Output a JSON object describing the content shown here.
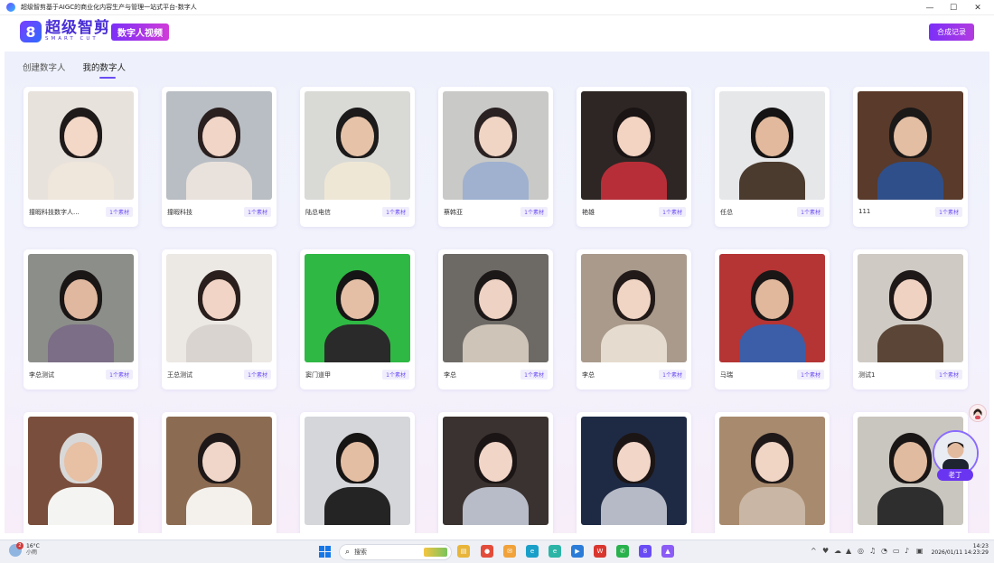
{
  "window": {
    "title": "超级智剪基于AIGC的商业化内容生产与管理一站式平台-数字人",
    "minimize_glyph": "—",
    "maximize_glyph": "☐",
    "close_glyph": "✕"
  },
  "header": {
    "logo_mark": "8",
    "logo_cn": "超级智剪",
    "logo_en": "SMART CUT",
    "product_badge": "数字人视频",
    "records_button": "合成记录"
  },
  "tabs": [
    {
      "label": "创建数字人",
      "active": false
    },
    {
      "label": "我的数字人",
      "active": true
    }
  ],
  "avatars": [
    {
      "name": "撞暇科技数字人...",
      "count": "1个素材",
      "bg": "#e8e2dc",
      "skin": "#f3d8c8",
      "hair": "#1f1a1a",
      "cloth": "#efe6dc"
    },
    {
      "name": "撞暇科技",
      "count": "1个素材",
      "bg": "#b9bec4",
      "skin": "#f1d6c8",
      "hair": "#2a2020",
      "cloth": "#e9e2dc"
    },
    {
      "name": "陆总电信",
      "count": "1个素材",
      "bg": "#d9dad6",
      "skin": "#e6c3a8",
      "hair": "#1c1a1a",
      "cloth": "#efe7d5"
    },
    {
      "name": "蔡韩亚",
      "count": "1个素材",
      "bg": "#c9c9c7",
      "skin": "#f0d5c5",
      "hair": "#2a2222",
      "cloth": "#9fb1cf"
    },
    {
      "name": "艳雄",
      "count": "1个素材",
      "bg": "#2d2624",
      "skin": "#f3d3c2",
      "hair": "#1a1414",
      "cloth": "#b82e38"
    },
    {
      "name": "任总",
      "count": "1个素材",
      "bg": "#e6e7e9",
      "skin": "#e2b99c",
      "hair": "#151313",
      "cloth": "#4b3a2e"
    },
    {
      "name": "111",
      "count": "1个素材",
      "bg": "#5a3a2a",
      "skin": "#e3bea3",
      "hair": "#1b1818",
      "cloth": "#2f4f8a"
    },
    {
      "name": "李总测试",
      "count": "1个素材",
      "bg": "#8c8e8a",
      "skin": "#e0b89f",
      "hair": "#1a1616",
      "cloth": "#7c6e86"
    },
    {
      "name": "王总测试",
      "count": "1个素材",
      "bg": "#ece8e3",
      "skin": "#f2d4c6",
      "hair": "#2a1f1c",
      "cloth": "#d9d4d0"
    },
    {
      "name": "窦门道甲",
      "count": "1个素材",
      "bg": "#2fb843",
      "skin": "#e4bfa6",
      "hair": "#151515",
      "cloth": "#2a2a2a"
    },
    {
      "name": "李总",
      "count": "1个素材",
      "bg": "#6d6a66",
      "skin": "#eed2c3",
      "hair": "#1d1818",
      "cloth": "#cfc4b8"
    },
    {
      "name": "李总",
      "count": "1个素材",
      "bg": "#a99a8c",
      "skin": "#f0d4c4",
      "hair": "#221a18",
      "cloth": "#e5dccf"
    },
    {
      "name": "马瑞",
      "count": "1个素材",
      "bg": "#b53434",
      "skin": "#e1b89c",
      "hair": "#1a1616",
      "cloth": "#3c5ea8"
    },
    {
      "name": "测试1",
      "count": "1个素材",
      "bg": "#cfcac4",
      "skin": "#f0d2c2",
      "hair": "#1f1818",
      "cloth": "#5a4536"
    },
    {
      "name": "",
      "count": "",
      "bg": "#7a4e3c",
      "skin": "#e8c0a4",
      "hair": "#d8d8d8",
      "cloth": "#f4f4f2"
    },
    {
      "name": "",
      "count": "",
      "bg": "#8b6b52",
      "skin": "#f0d6c8",
      "hair": "#1e1818",
      "cloth": "#f4f1ec"
    },
    {
      "name": "",
      "count": "",
      "bg": "#d4d6da",
      "skin": "#e4bea3",
      "hair": "#171414",
      "cloth": "#242424"
    },
    {
      "name": "",
      "count": "",
      "bg": "#3a3230",
      "skin": "#f1d5c7",
      "hair": "#1c1515",
      "cloth": "#b8bcc8"
    },
    {
      "name": "",
      "count": "",
      "bg": "#1e2a44",
      "skin": "#f2d6c8",
      "hair": "#1c1515",
      "cloth": "#b6bac6"
    },
    {
      "name": "",
      "count": "",
      "bg": "#a88a6e",
      "skin": "#f0d4c4",
      "hair": "#1f1818",
      "cloth": "#c9b6a4"
    },
    {
      "name": "",
      "count": "",
      "bg": "#c9c6bf",
      "skin": "#e1bb9f",
      "hair": "#1a1616",
      "cloth": "#2e2e2e"
    }
  ],
  "helper": {
    "label": "老丁"
  },
  "taskbar": {
    "weather_temp": "16°C",
    "weather_desc": "小雨",
    "weather_badge": "2",
    "search_placeholder": "搜索",
    "search_icon": "⌕",
    "time": "14:23",
    "date": "2026/01/11 14:23:29",
    "apps": [
      {
        "name": "file-explorer-icon",
        "color": "#e8b53a",
        "glyph": "▤"
      },
      {
        "name": "chrome-icon",
        "color": "#e34c3a",
        "glyph": "●"
      },
      {
        "name": "mail-icon",
        "color": "#f1a23a",
        "glyph": "✉"
      },
      {
        "name": "edge-icon",
        "color": "#1aa0c8",
        "glyph": "e"
      },
      {
        "name": "edge-alt-icon",
        "color": "#2cb4a6",
        "glyph": "e"
      },
      {
        "name": "video-icon",
        "color": "#2b7cd8",
        "glyph": "▶"
      },
      {
        "name": "wps-icon",
        "color": "#d9362f",
        "glyph": "W"
      },
      {
        "name": "wechat-icon",
        "color": "#28b14c",
        "glyph": "✆"
      },
      {
        "name": "smartcut-taskbar-icon",
        "color": "#6a4cf5",
        "glyph": "8"
      },
      {
        "name": "design-icon",
        "color": "#8b5cf6",
        "glyph": "▲"
      }
    ],
    "tray": [
      "^",
      "♥",
      "☁",
      "▲",
      "◎",
      "♫",
      "◔",
      "▭",
      "♪",
      "▣"
    ]
  }
}
